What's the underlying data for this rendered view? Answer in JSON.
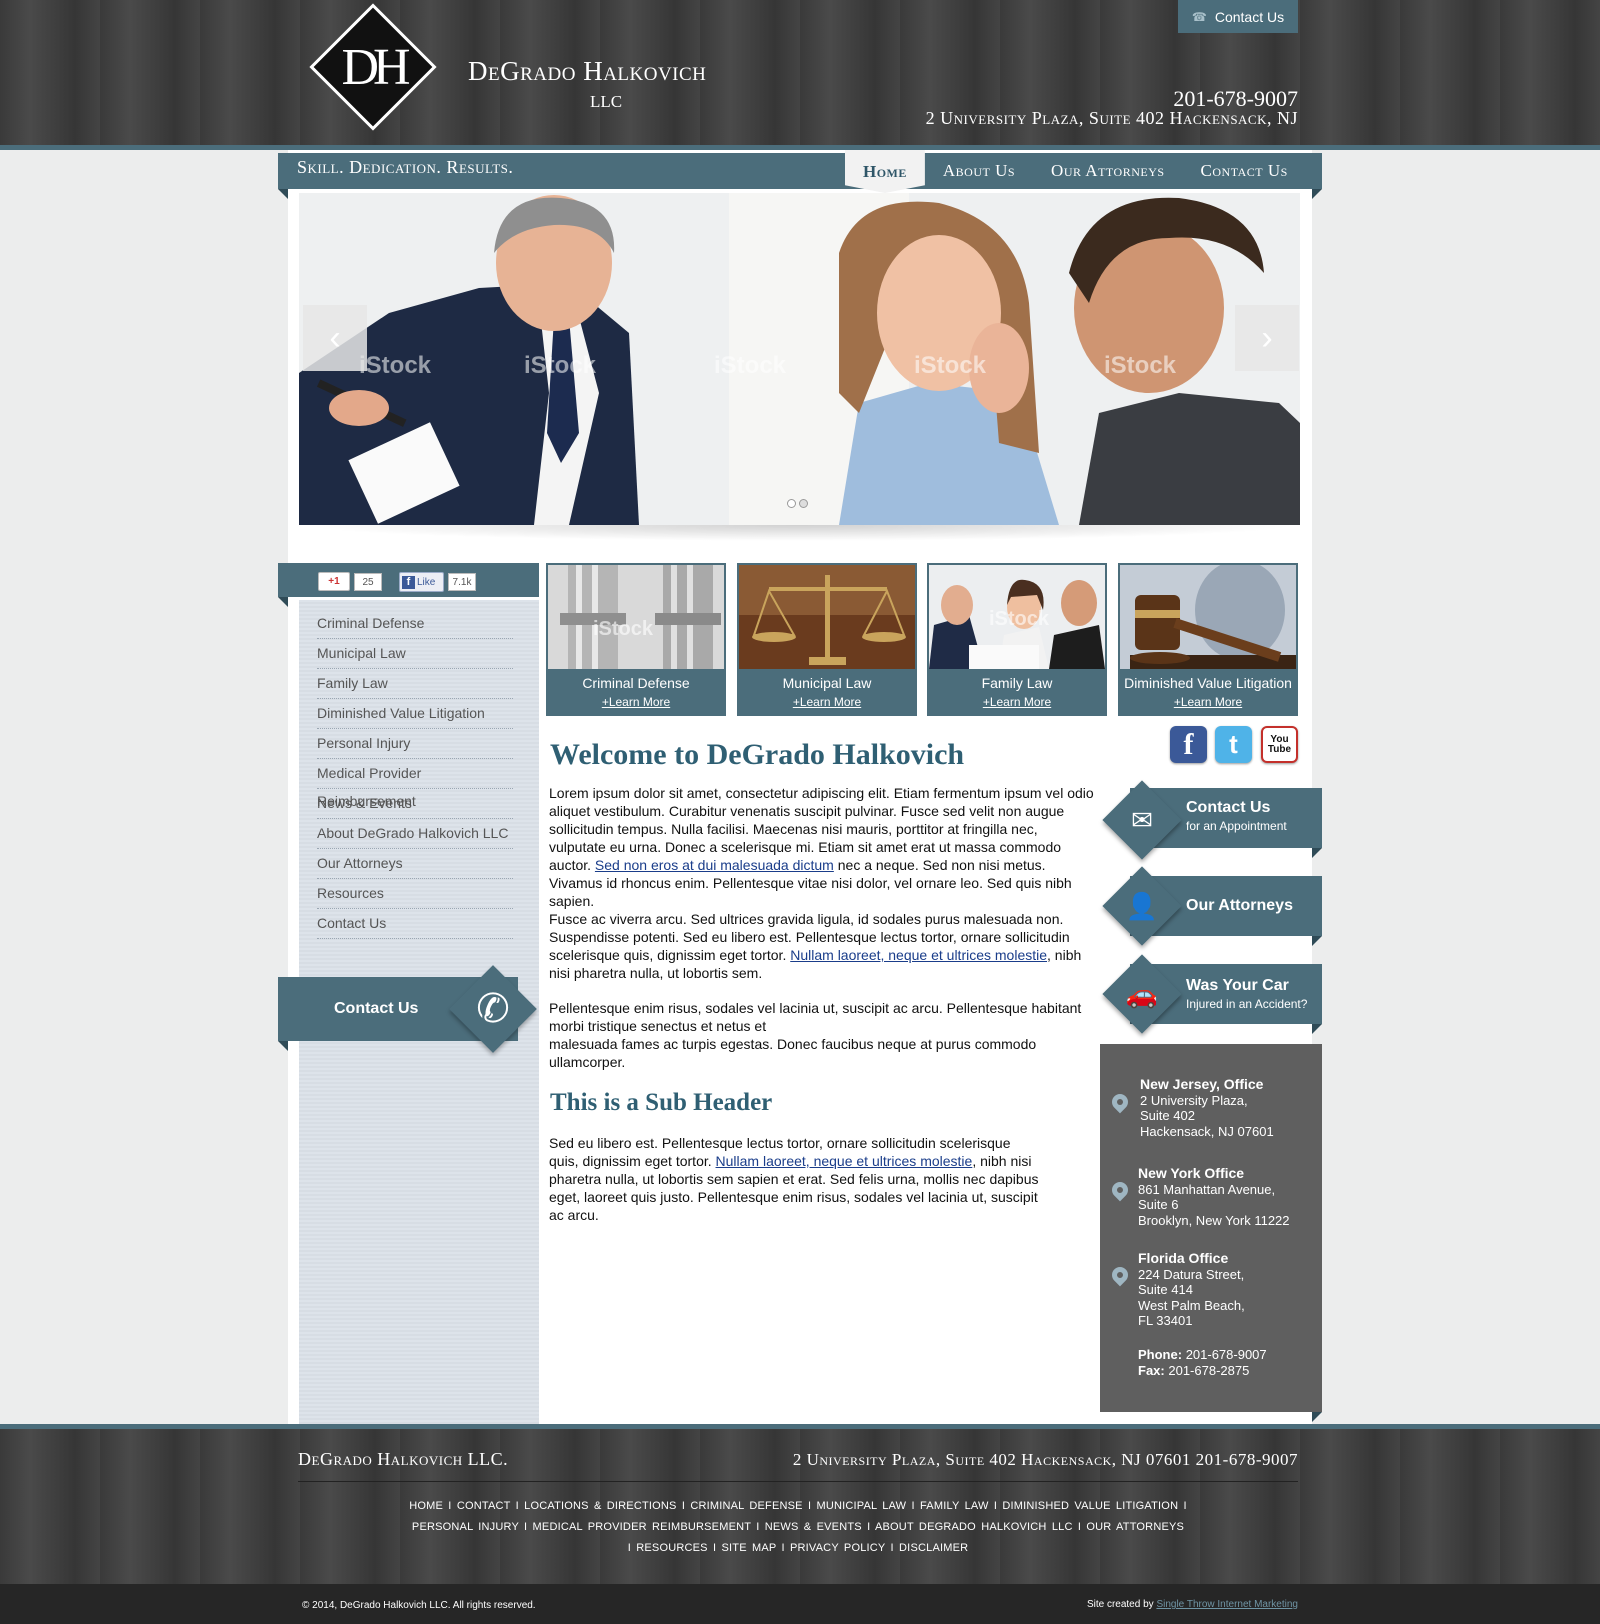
{
  "header": {
    "top_contact": "Contact Us",
    "logo_initials": "DH",
    "logo_name": "DeGrado Halkovich",
    "logo_suffix": "LLC",
    "phone": "201-678-9007",
    "address": "2 University Plaza, Suite 402 Hackensack, NJ"
  },
  "nav": {
    "tagline": "Skill. Dedication. Results.",
    "items": [
      "Home",
      "About Us",
      "Our Attorneys",
      "Contact Us"
    ],
    "active": "Home"
  },
  "slider": {
    "watermark": "iStock",
    "dots": 2,
    "active_dot": 1
  },
  "social_counts": {
    "gplus_label": "+1",
    "gplus_count": "25",
    "fb_label": "Like",
    "fb_count": "7.1k"
  },
  "sidebar": {
    "items": [
      "Criminal Defense",
      "Municipal Law",
      "Family Law",
      "Diminished Value Litigation",
      "Personal Injury",
      "Medical Provider Reimbursement",
      "News & Events",
      "About DeGrado Halkovich LLC",
      "Our Attorneys",
      "Resources",
      "Contact Us"
    ],
    "contact_label": "Contact Us"
  },
  "practice_areas": [
    {
      "title": "Criminal Defense",
      "link": "+Learn More"
    },
    {
      "title": "Municipal Law",
      "link": "+Learn More"
    },
    {
      "title": "Family Law",
      "link": "+Learn More"
    },
    {
      "title": "Diminished Value Litigation",
      "link": "+Learn More"
    }
  ],
  "main": {
    "welcome": "Welcome to DeGrado Halkovich",
    "p1_a": "Lorem ipsum dolor sit amet, consectetur adipiscing elit. Etiam fermentum ipsum vel odio aliquet vestibulum. Curabitur venenatis suscipit pulvinar. Fusce sed velit non augue sollicitudin tempus. Nulla facilisi. Maecenas nisi mauris, porttitor at fringilla nec, vulputate eu urna. Donec a scelerisque mi. Etiam sit amet erat ut massa commodo auctor. ",
    "p1_link": "Sed non eros at dui malesuada dictum",
    "p1_b": " nec a neque. Sed non nisi metus. Vivamus id rhoncus enim. Pellentesque vitae nisi dolor, vel ornare leo. Sed quis nibh sapien.",
    "p2_a": "Fusce ac viverra arcu. Sed ultrices gravida ligula, id sodales purus malesuada non. Suspendisse potenti. Sed eu libero est. Pellentesque lectus tortor, ornare sollicitudin scelerisque quis, dignissim eget tortor. ",
    "p2_link": "Nullam laoreet, neque et ultrices molestie",
    "p2_b": ", nibh nisi pharetra nulla, ut lobortis sem.",
    "p3_a": "Pellentesque enim risus, sodales vel lacinia ut, suscipit ac arcu. Pellentesque habitant morbi tristique senectus et netus et",
    "p3_b": "malesuada fames ac turpis egestas. Donec faucibus neque at purus commodo ullamcorper.",
    "subheader": "This is a Sub Header",
    "p4_a": "Sed eu libero est. Pellentesque lectus tortor, ornare sollicitudin scelerisque quis, dignissim eget tortor. ",
    "p4_link": "Nullam laoreet, neque et ultrices molestie",
    "p4_b": ", nibh nisi pharetra nulla, ut lobortis sem sapien et erat. Sed felis urna, mollis nec dapibus eget, laoreet quis justo. Pellentesque enim risus, sodales vel lacinia ut, suscipit ac arcu."
  },
  "right": {
    "social": [
      {
        "name": "facebook",
        "glyph": "f",
        "color": "#3b5998"
      },
      {
        "name": "twitter",
        "glyph": "t",
        "color": "#4fb3e8"
      },
      {
        "name": "youtube",
        "glyph": "You Tube",
        "color": "#c4302b"
      }
    ],
    "cta": [
      {
        "title": "Contact Us",
        "sub": "for an Appointment"
      },
      {
        "title": "Our Attorneys",
        "sub": ""
      },
      {
        "title": "Was Your Car",
        "sub": "Injured in an Accident?"
      }
    ],
    "offices": [
      {
        "name": "New Jersey, Office",
        "lines": [
          "2 University Plaza,",
          "Suite 402",
          "Hackensack, NJ 07601"
        ]
      },
      {
        "name": "New York Office",
        "lines": [
          "861 Manhattan Avenue,",
          "Suite 6",
          "Brooklyn, New York 11222"
        ]
      },
      {
        "name": "Florida Office",
        "lines": [
          "224 Datura Street,",
          "Suite 414",
          "West Palm Beach,",
          "FL 33401"
        ]
      }
    ],
    "phone_label": "Phone:",
    "phone": "201-678-9007",
    "fax_label": "Fax:",
    "fax": "201-678-2875"
  },
  "footer": {
    "name": "DeGrado Halkovich LLC.",
    "address": "2 University Plaza, Suite 402 Hackensack, NJ 07601  201-678-9007",
    "links_row1": "HOME I CONTACT  I  LOCATIONS & DIRECTIONS  I  CRIMINAL DEFENSE  I  MUNICIPAL LAW  I  FAMILY LAW  I   DIMINISHED VALUE LITIGATION  I",
    "links_row2": "PERSONAL INJURY  I  MEDICAL PROVIDER REIMBURSEMENT  I  NEWS & EVENTS  I  ABOUT DEGRADO HALKOVICH LLC  I  OUR ATTORNEYS",
    "links_row3": "I  RESOURCES  I  SITE MAP  I  PRIVACY POLICY  I  DISCLAIMER",
    "copyright": "© 2014, DeGrado Halkovich LLC. All rights reserved.",
    "credit_label": "Site created by",
    "credit_link": "Single Throw Internet Marketing"
  },
  "colors": {
    "accent": "#4b6d7b",
    "heading": "#2f5f73",
    "office_bg": "#5f5f5f"
  }
}
